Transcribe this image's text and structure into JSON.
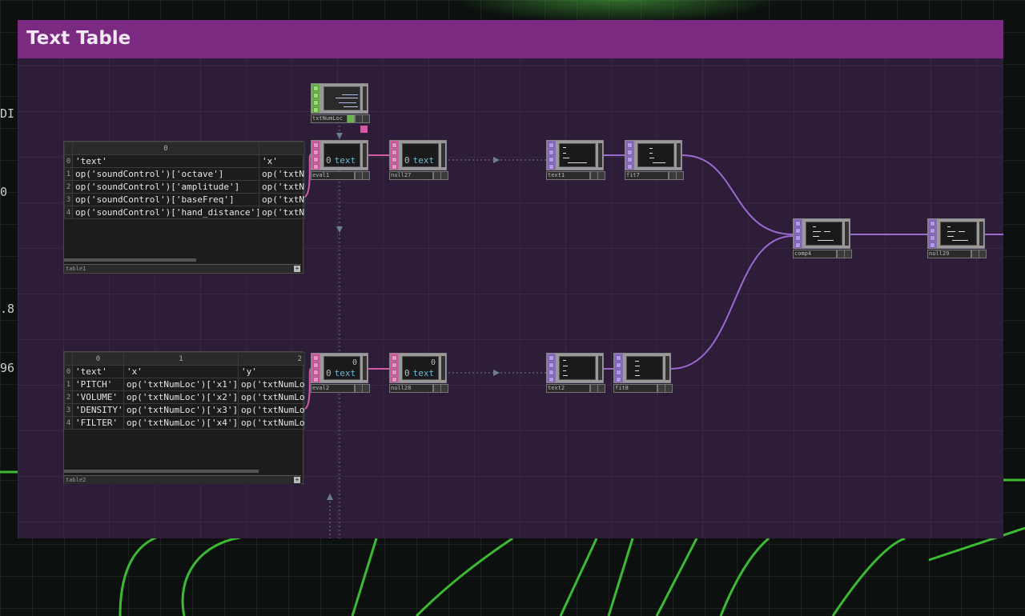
{
  "title": "Text Table",
  "edge_labels": [
    "DI",
    "0",
    ".8",
    "96"
  ],
  "table1": {
    "name": "table1",
    "headers": [
      "0"
    ],
    "rows": [
      {
        "idx": "0",
        "c0": "'text'",
        "c1": "'x'"
      },
      {
        "idx": "1",
        "c0": "op('soundControl')['octave']",
        "c1": "op('txtN"
      },
      {
        "idx": "2",
        "c0": "op('soundControl')['amplitude']",
        "c1": "op('txtN"
      },
      {
        "idx": "3",
        "c0": "op('soundControl')['baseFreq']",
        "c1": "op('txtN"
      },
      {
        "idx": "4",
        "c0": "op('soundControl')['hand_distance']",
        "c1": "op('txtN"
      }
    ]
  },
  "table2": {
    "name": "table2",
    "headers": [
      "0",
      "1",
      "2"
    ],
    "rows": [
      {
        "idx": "0",
        "c0": "'text'",
        "c1": "'x'",
        "c2": "'y'"
      },
      {
        "idx": "1",
        "c0": "'PITCH'",
        "c1": "op('txtNumLoc')['x1']",
        "c2": "op('txtNumLoc"
      },
      {
        "idx": "2",
        "c0": "'VOLUME'",
        "c1": "op('txtNumLoc')['x2']",
        "c2": "op('txtNumLoc"
      },
      {
        "idx": "3",
        "c0": "'DENSITY'",
        "c1": "op('txtNumLoc')['x3']",
        "c2": "op('txtNumLoc"
      },
      {
        "idx": "4",
        "c0": "'FILTER'",
        "c1": "op('txtNumLoc')['x4']",
        "c2": "op('txtNumLoc"
      }
    ]
  },
  "nodes": {
    "txtNumLoc": {
      "label": "txtNumLoc"
    },
    "eval1": {
      "label": "eval1",
      "zero": "0",
      "text": "text"
    },
    "null27": {
      "label": "null27",
      "zero": "0",
      "text": "text"
    },
    "text1": {
      "label": "text1"
    },
    "fit7": {
      "label": "fit7"
    },
    "comp4": {
      "label": "comp4"
    },
    "null29": {
      "label": "null29"
    },
    "eval2": {
      "label": "eval2",
      "zero": "0",
      "text": "text",
      "num": "0"
    },
    "null28": {
      "label": "null28",
      "zero": "0",
      "text": "text",
      "num": "0"
    },
    "text2": {
      "label": "text2"
    },
    "fit8": {
      "label": "fit8"
    }
  },
  "colors": {
    "panel": "#2e1d38",
    "title_bar": "#7b2a82",
    "dat_wire": "#d45aa6",
    "top_wire": "#9b6ad0",
    "glow": "#46c83c"
  }
}
